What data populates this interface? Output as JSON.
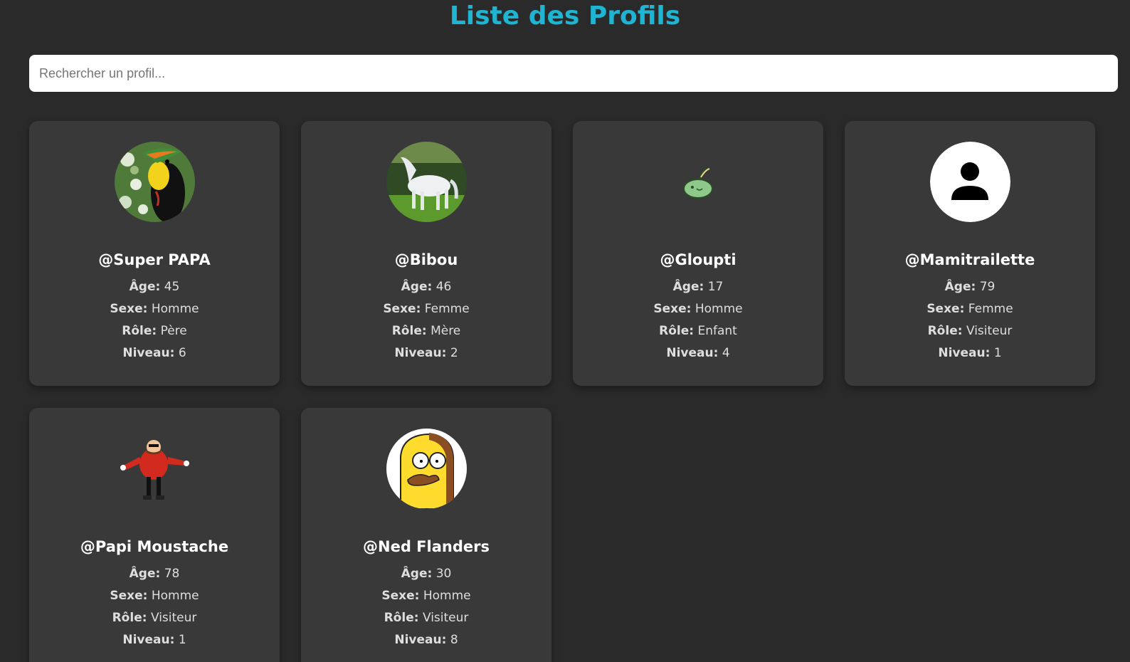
{
  "page": {
    "title": "Liste des Profils",
    "search_placeholder": "Rechercher un profil..."
  },
  "labels": {
    "age": "Âge:",
    "sexe": "Sexe:",
    "role": "Rôle:",
    "niveau": "Niveau:"
  },
  "colors": {
    "accent": "#1fb5d2",
    "background": "#2a2a2a",
    "card": "#393939"
  },
  "profiles": [
    {
      "username": "@Super PAPA",
      "age": "45",
      "sexe": "Homme",
      "role": "Père",
      "niveau": "6",
      "avatar": "toucan-photo"
    },
    {
      "username": "@Bibou",
      "age": "46",
      "sexe": "Femme",
      "role": "Mère",
      "niveau": "2",
      "avatar": "white-horse-photo"
    },
    {
      "username": "@Gloupti",
      "age": "17",
      "sexe": "Homme",
      "role": "Enfant",
      "niveau": "4",
      "avatar": "green-blob-sprite"
    },
    {
      "username": "@Mamitrailette",
      "age": "79",
      "sexe": "Femme",
      "role": "Visiteur",
      "niveau": "1",
      "avatar": "default-user-icon"
    },
    {
      "username": "@Papi Moustache",
      "age": "78",
      "sexe": "Homme",
      "role": "Visiteur",
      "niveau": "1",
      "avatar": "eggman-character"
    },
    {
      "username": "@Ned Flanders",
      "age": "30",
      "sexe": "Homme",
      "role": "Visiteur",
      "niveau": "8",
      "avatar": "ned-flanders-cartoon"
    }
  ]
}
